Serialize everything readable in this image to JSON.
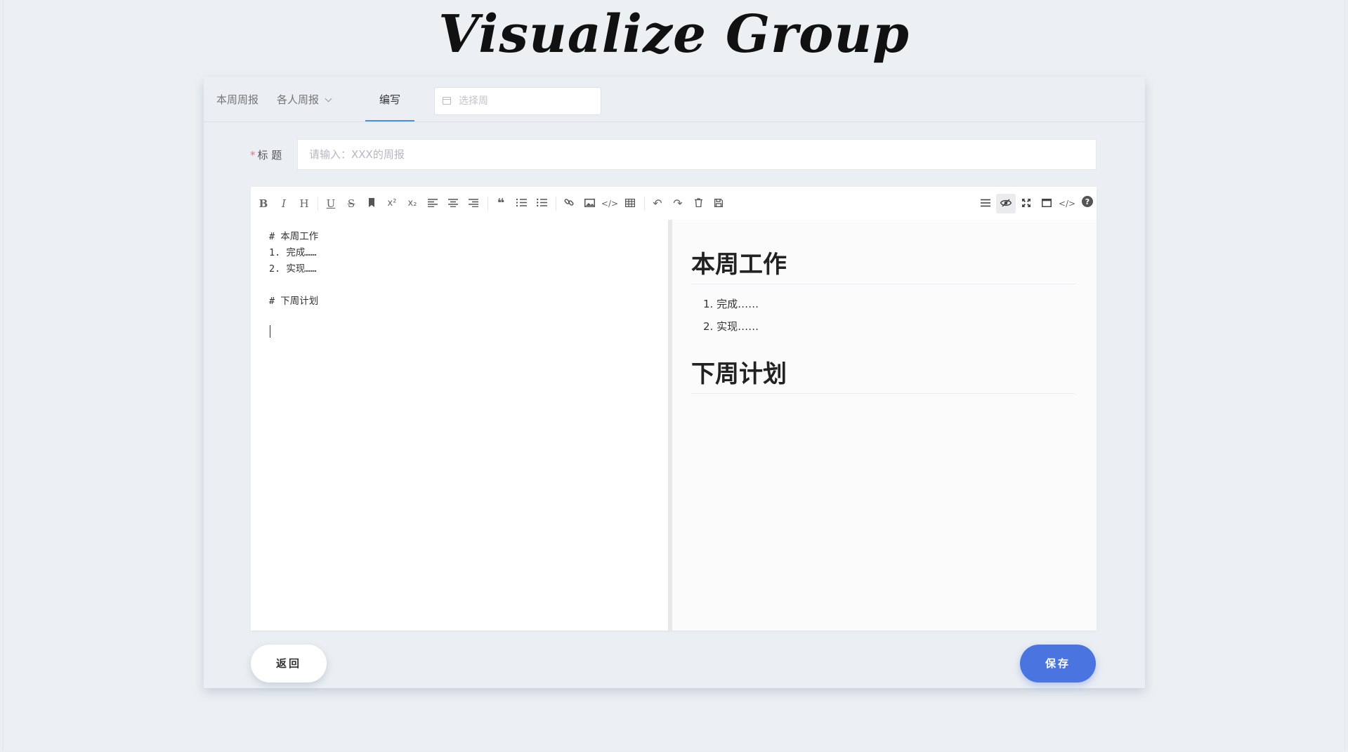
{
  "logo": "Visualize Group",
  "nav": {
    "items": [
      {
        "label": "本周周报"
      },
      {
        "label": "各人周报"
      },
      {
        "label": "编写"
      }
    ],
    "week_placeholder": "选择周"
  },
  "form": {
    "title_label": "标 题",
    "required_mark": "*",
    "title_placeholder": "请输入：XXX的周报"
  },
  "toolbar": {
    "left": [
      "bold-icon",
      "italic-icon",
      "header-icon",
      "underline-icon",
      "strikethrough-icon",
      "bookmark-icon",
      "superscript-icon",
      "subscript-icon",
      "align-left-icon",
      "align-center-icon",
      "align-right-icon",
      "quote-icon",
      "ordered-list-icon",
      "unordered-list-icon",
      "link-icon",
      "image-icon",
      "code-icon",
      "table-icon",
      "undo-icon",
      "redo-icon",
      "trash-icon",
      "save-icon"
    ],
    "right": [
      "menu-icon",
      "preview-icon",
      "fullscreen-icon",
      "window-icon",
      "html-code-icon",
      "help-icon"
    ]
  },
  "source": {
    "lines": [
      "# 本周工作",
      "1. 完成……",
      "2. 实现……",
      "# 下周计划"
    ]
  },
  "preview": {
    "h1_this_week": "本周工作",
    "items": [
      "完成……",
      "实现……"
    ],
    "h1_next_week": "下周计划"
  },
  "buttons": {
    "back": "返回",
    "save": "保存"
  },
  "colors": {
    "accent": "#4a74e0",
    "tab_underline": "#4a90e2",
    "required": "#f56c6c"
  }
}
